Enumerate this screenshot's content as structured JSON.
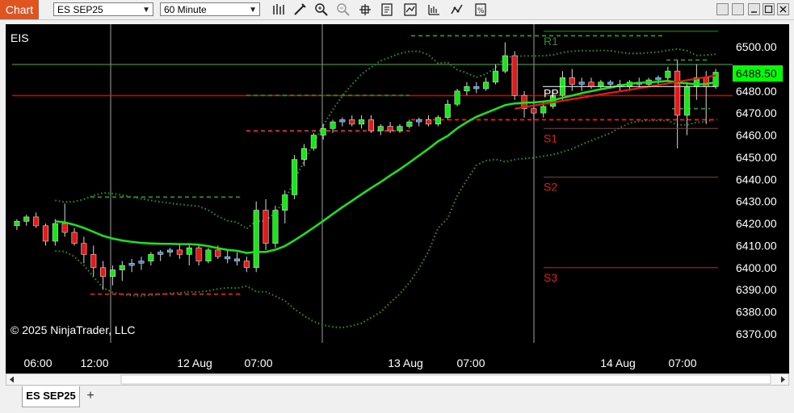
{
  "toolbar": {
    "chart_label": "Chart",
    "instrument": "ES SEP25",
    "interval": "60 Minute",
    "icons": [
      "bars-icon",
      "draw-icon",
      "zoom-in-icon",
      "zoom-out-icon",
      "crosshair-icon",
      "properties-icon",
      "strategy-icon",
      "indicator-icon",
      "analysis-icon",
      "data-box-icon"
    ]
  },
  "chart": {
    "label": "EIS",
    "copyright": "© 2025 NinjaTrader, LLC",
    "current_price": "6488.50",
    "colors": {
      "up": "#19e619",
      "down": "#e61919",
      "neutral": "#3c8ce6",
      "price_badge": "#00ff00"
    }
  },
  "chart_data": {
    "type": "candlestick",
    "instrument": "ES SEP25",
    "interval": "60 Minute",
    "ylim": [
      6365,
      6508
    ],
    "y_ticks": [
      "6500.00",
      "6490.00",
      "6480.00",
      "6470.00",
      "6460.00",
      "6450.00",
      "6440.00",
      "6430.00",
      "6420.00",
      "6410.00",
      "6400.00",
      "6390.00",
      "6380.00",
      "6370.00"
    ],
    "x_ticks": [
      "06:00",
      "12:00",
      "12 Aug",
      "07:00",
      "13 Aug",
      "07:00",
      "14 Aug",
      "07:00"
    ],
    "pivot_labels": [
      "R1",
      "PP",
      "S1",
      "S2",
      "S3"
    ],
    "pivot_levels": {
      "R1": 6504,
      "PP": 6483,
      "S1": 6463,
      "S2": 6441,
      "S3": 6400
    },
    "horizontal_lines": [
      6492,
      6478
    ],
    "candles": [
      [
        6419,
        6422,
        6417,
        6421
      ],
      [
        6421,
        6424,
        6419,
        6423
      ],
      [
        6423,
        6425,
        6418,
        6419
      ],
      [
        6419,
        6420,
        6410,
        6412
      ],
      [
        6412,
        6422,
        6410,
        6420
      ],
      [
        6420,
        6429,
        6414,
        6416
      ],
      [
        6416,
        6418,
        6410,
        6411
      ],
      [
        6411,
        6414,
        6402,
        6406
      ],
      [
        6406,
        6410,
        6396,
        6400
      ],
      [
        6400,
        6403,
        6390,
        6396
      ],
      [
        6396,
        6401,
        6392,
        6399
      ],
      [
        6399,
        6403,
        6394,
        6401
      ],
      [
        6401,
        6404,
        6398,
        6402
      ],
      [
        6402,
        6405,
        6399,
        6403
      ],
      [
        6403,
        6407,
        6401,
        6406
      ],
      [
        6406,
        6408,
        6403,
        6407
      ],
      [
        6407,
        6409,
        6405,
        6408
      ],
      [
        6408,
        6411,
        6404,
        6406
      ],
      [
        6406,
        6411,
        6401,
        6409
      ],
      [
        6409,
        6410,
        6401,
        6403
      ],
      [
        6403,
        6409,
        6402,
        6408
      ],
      [
        6408,
        6410,
        6404,
        6405
      ],
      [
        6405,
        6408,
        6402,
        6404
      ],
      [
        6404,
        6407,
        6401,
        6403
      ],
      [
        6403,
        6405,
        6398,
        6400
      ],
      [
        6400,
        6430,
        6398,
        6426
      ],
      [
        6426,
        6431,
        6408,
        6411
      ],
      [
        6411,
        6428,
        6409,
        6426
      ],
      [
        6426,
        6435,
        6420,
        6433
      ],
      [
        6433,
        6451,
        6431,
        6449
      ],
      [
        6449,
        6456,
        6446,
        6454
      ],
      [
        6454,
        6461,
        6453,
        6460
      ],
      [
        6460,
        6465,
        6458,
        6463
      ],
      [
        6463,
        6467,
        6461,
        6466
      ],
      [
        6466,
        6468,
        6464,
        6467
      ],
      [
        6467,
        6469,
        6464,
        6465
      ],
      [
        6465,
        6469,
        6463,
        6467
      ],
      [
        6467,
        6469,
        6461,
        6462
      ],
      [
        6462,
        6465,
        6460,
        6464
      ],
      [
        6464,
        6466,
        6461,
        6462
      ],
      [
        6462,
        6465,
        6461,
        6464
      ],
      [
        6464,
        6467,
        6463,
        6466
      ],
      [
        6466,
        6468,
        6464,
        6467
      ],
      [
        6467,
        6469,
        6464,
        6465
      ],
      [
        6465,
        6469,
        6464,
        6468
      ],
      [
        6468,
        6476,
        6467,
        6474
      ],
      [
        6474,
        6481,
        6473,
        6480
      ],
      [
        6480,
        6484,
        6478,
        6482
      ],
      [
        6482,
        6484,
        6479,
        6481
      ],
      [
        6481,
        6486,
        6480,
        6484
      ],
      [
        6484,
        6492,
        6483,
        6489
      ],
      [
        6489,
        6502,
        6488,
        6496
      ],
      [
        6496,
        6498,
        6476,
        6478
      ],
      [
        6478,
        6480,
        6468,
        6472
      ],
      [
        6472,
        6476,
        6467,
        6470
      ],
      [
        6470,
        6475,
        6468,
        6473
      ],
      [
        6473,
        6480,
        6472,
        6478
      ],
      [
        6478,
        6489,
        6476,
        6486
      ],
      [
        6486,
        6490,
        6480,
        6483
      ],
      [
        6483,
        6486,
        6480,
        6484
      ],
      [
        6484,
        6486,
        6481,
        6482
      ],
      [
        6482,
        6485,
        6481,
        6484
      ],
      [
        6484,
        6485,
        6481,
        6483
      ],
      [
        6483,
        6485,
        6480,
        6482
      ],
      [
        6482,
        6485,
        6480,
        6484
      ],
      [
        6484,
        6486,
        6481,
        6483
      ],
      [
        6483,
        6486,
        6482,
        6485
      ],
      [
        6485,
        6487,
        6483,
        6486
      ],
      [
        6486,
        6491,
        6484,
        6489
      ],
      [
        6489,
        6494,
        6454,
        6469
      ],
      [
        6469,
        6484,
        6460,
        6482
      ],
      [
        6482,
        6492,
        6476,
        6486
      ],
      [
        6486,
        6489,
        6465,
        6482
      ],
      [
        6482,
        6490,
        6481,
        6488.5
      ]
    ],
    "series": [
      {
        "name": "SMA",
        "type": "line"
      },
      {
        "name": "Bollinger Upper",
        "type": "dotted-line"
      },
      {
        "name": "Bollinger Lower",
        "type": "dotted-line"
      },
      {
        "name": "Trend Line",
        "type": "line"
      }
    ]
  },
  "tabs": {
    "items": [
      {
        "label": "ES SEP25"
      }
    ],
    "add_label": "+"
  }
}
